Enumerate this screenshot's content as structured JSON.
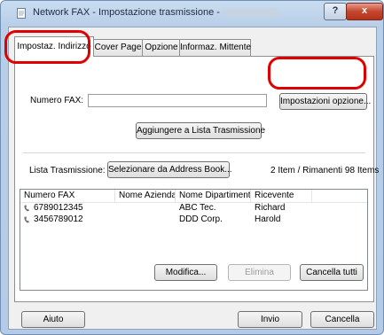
{
  "window": {
    "title": "Network FAX - Impostazione trasmissione -",
    "help_label": "?",
    "close_label": "x"
  },
  "tabs": [
    "Impostaz. Indirizzo",
    "Cover Page",
    "Opzione",
    "Informaz. Mittente"
  ],
  "address": {
    "fax_label": "Numero FAX:",
    "fax_value": "",
    "options_button": "Impostazioni opzione...",
    "add_button": "Aggiungere a Lista Trasmissione"
  },
  "broadcast": {
    "list_label": "Lista Trasmissione:",
    "address_book_button": "Selezionare da Address Book...",
    "count_text": "2 Item / Rimanenti 98 Items",
    "columns": [
      "Numero FAX",
      "Nome Azienda",
      "Nome Dipartimento",
      "Ricevente"
    ],
    "rows": [
      {
        "fax": "6789012345",
        "company": "",
        "department": "ABC Tec.",
        "recipient": "Richard"
      },
      {
        "fax": "3456789012",
        "company": "",
        "department": "DDD Corp.",
        "recipient": "Harold"
      }
    ],
    "modify_button": "Modifica...",
    "delete_button": "Elimina",
    "clear_button": "Cancella tutti"
  },
  "footer": {
    "help_button": "Aiuto",
    "send_button": "Invio",
    "cancel_button": "Cancella"
  },
  "colors": {
    "highlight": "#e00000",
    "titlebar": "#c9dcf0",
    "close_button": "#c4462d"
  }
}
